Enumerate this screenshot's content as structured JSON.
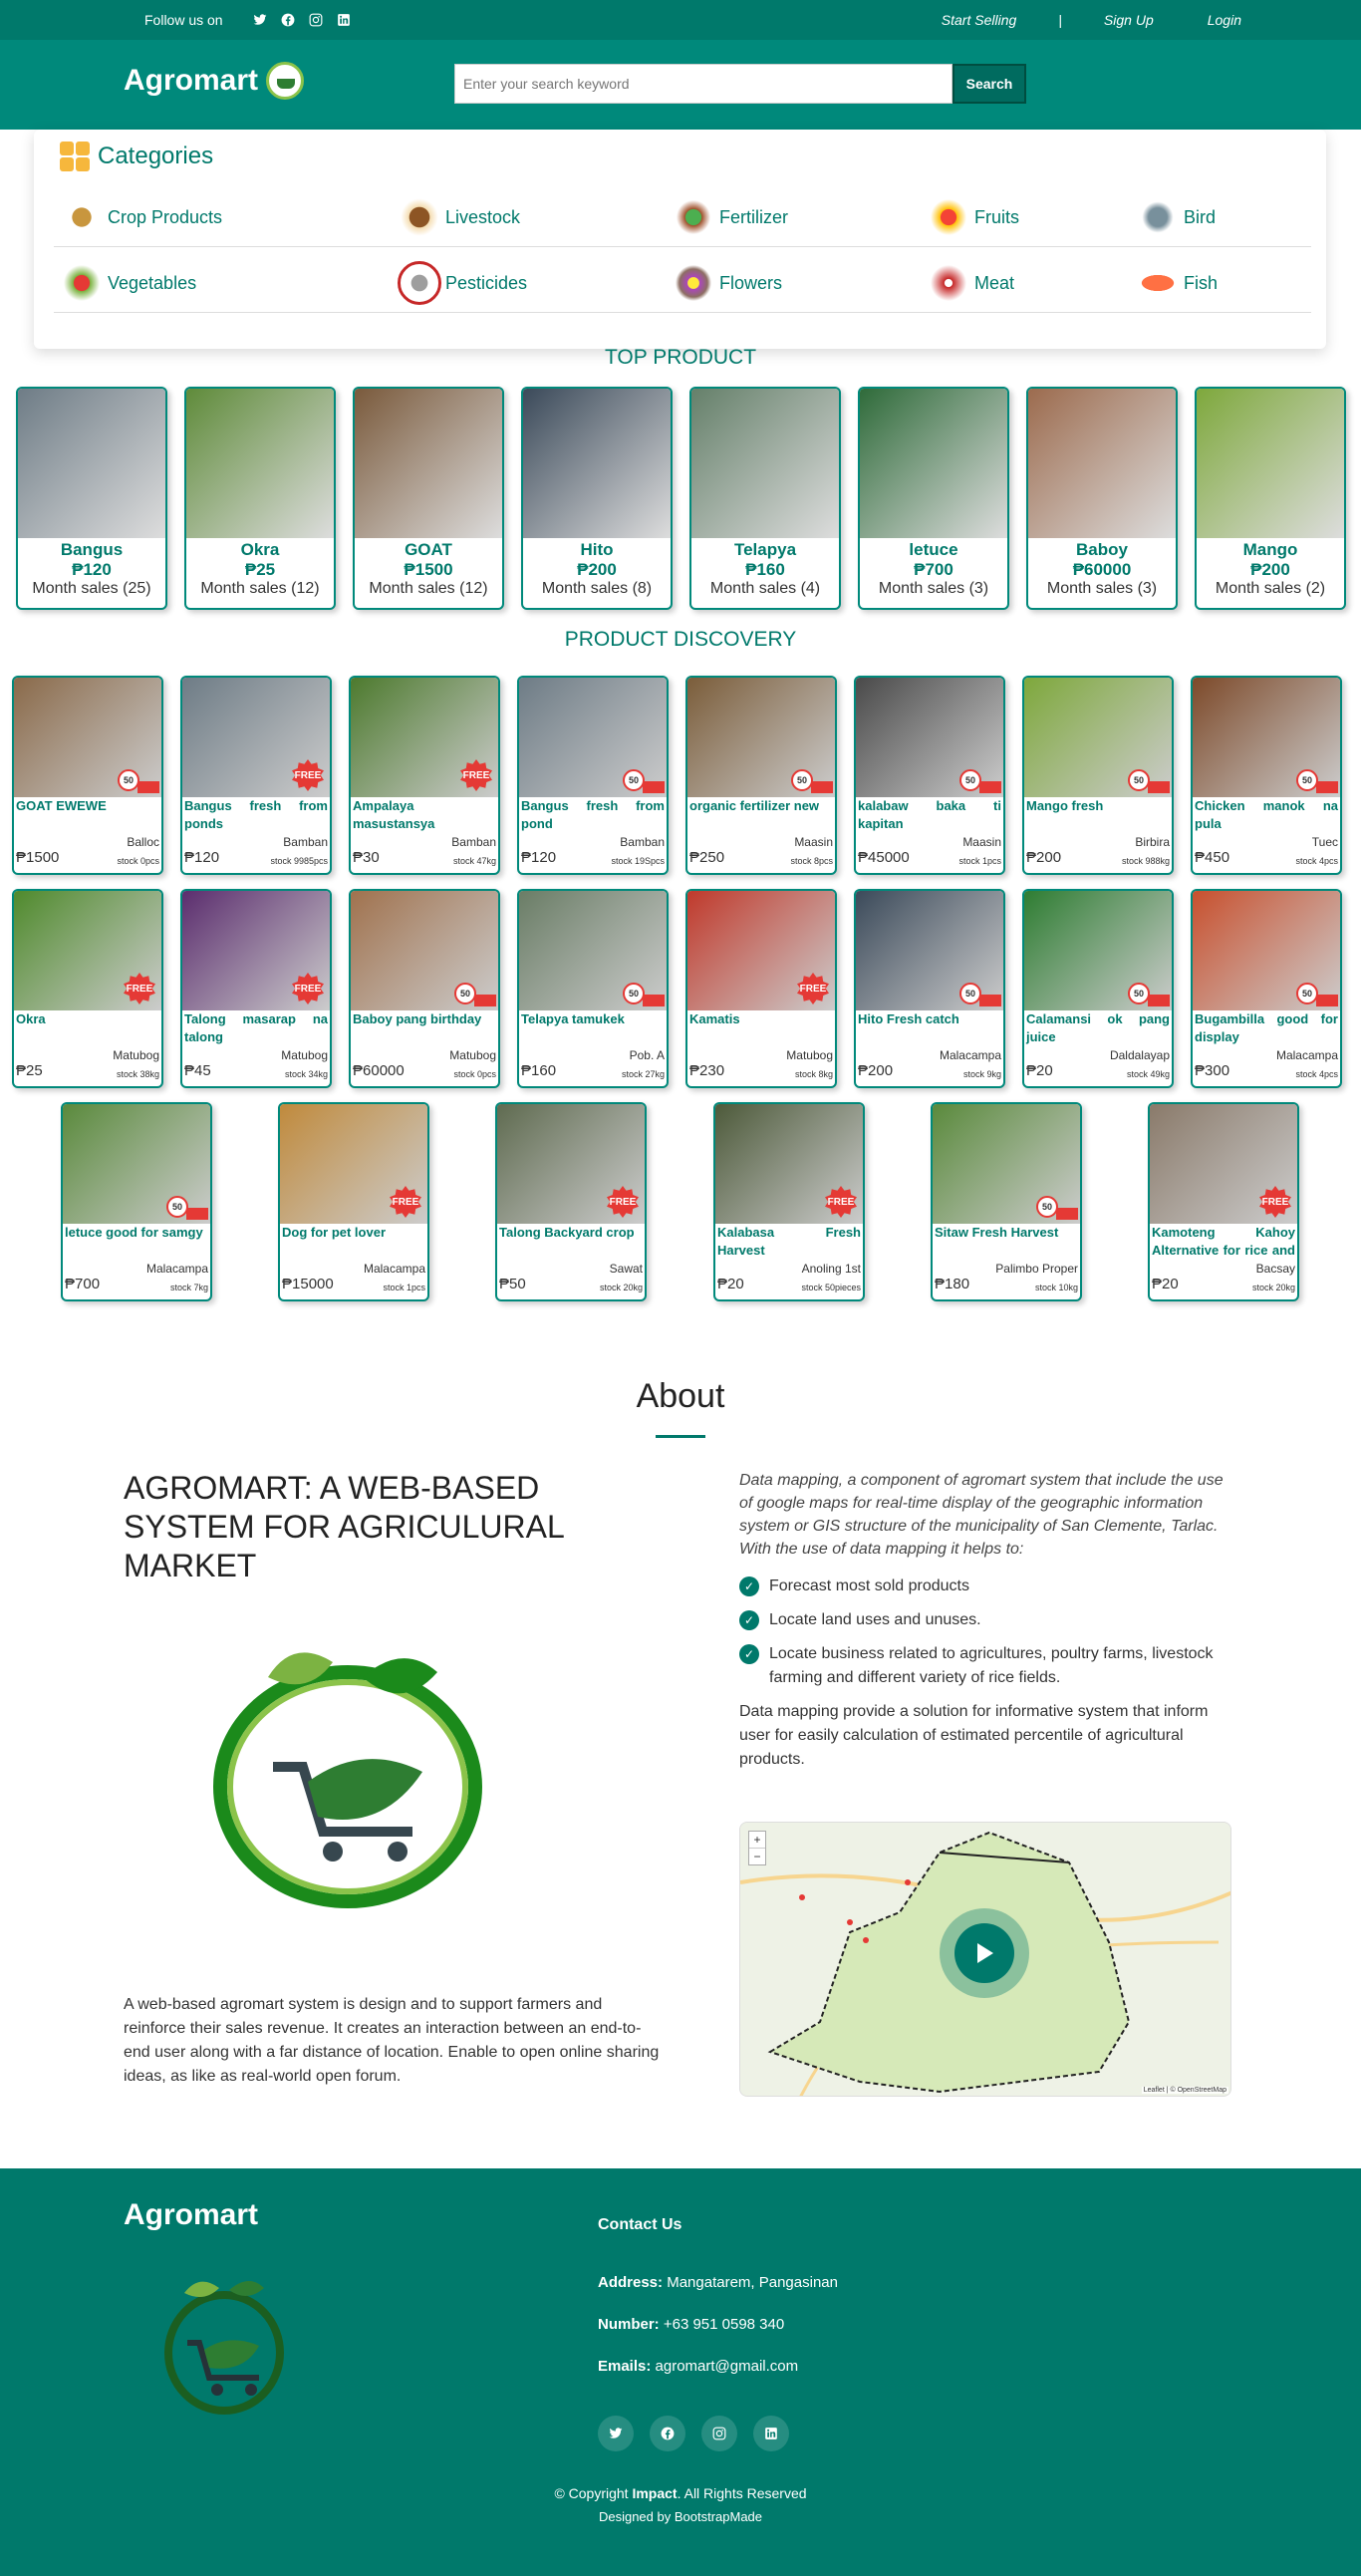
{
  "topbar": {
    "follow": "Follow us on",
    "start_selling": "Start Selling",
    "separator": "|",
    "sign_up": "Sign Up",
    "login": "Login"
  },
  "header": {
    "brand": "Agromart",
    "search_placeholder": "Enter your search keyword",
    "search_button": "Search"
  },
  "categories": {
    "title": "Categories",
    "row1": [
      "Crop Products",
      "Livestock",
      "Fertilizer",
      "Fruits",
      "Bird"
    ],
    "row2": [
      "Vegetables",
      "Pesticides",
      "Flowers",
      "Meat",
      "Fish"
    ]
  },
  "top_product": {
    "title": "TOP PRODUCT",
    "items": [
      {
        "name": "Bangus",
        "price": "₱120",
        "sales": "Month sales (25)"
      },
      {
        "name": "Okra",
        "price": "₱25",
        "sales": "Month sales (12)"
      },
      {
        "name": "GOAT",
        "price": "₱1500",
        "sales": "Month sales (12)"
      },
      {
        "name": "Hito",
        "price": "₱200",
        "sales": "Month sales (8)"
      },
      {
        "name": "Telapya",
        "price": "₱160",
        "sales": "Month sales (4)"
      },
      {
        "name": "letuce",
        "price": "₱700",
        "sales": "Month sales (3)"
      },
      {
        "name": "Baboy",
        "price": "₱60000",
        "sales": "Month sales (3)"
      },
      {
        "name": "Mango",
        "price": "₱200",
        "sales": "Month sales (2)"
      }
    ]
  },
  "discovery": {
    "title": "PRODUCT DISCOVERY",
    "items": [
      {
        "name": "GOAT EWEWE",
        "loc": "Balloc",
        "price": "₱1500",
        "stock": "stock 0pcs",
        "tag": "50"
      },
      {
        "name": "Bangus fresh from ponds",
        "loc": "Bamban",
        "price": "₱120",
        "stock": "stock 9985pcs",
        "tag": "FREE"
      },
      {
        "name": "Ampalaya masustansya",
        "loc": "Bamban",
        "price": "₱30",
        "stock": "stock 47kg",
        "tag": "FREE"
      },
      {
        "name": "Bangus fresh from pond",
        "loc": "Bamban",
        "price": "₱120",
        "stock": "stock 19Spcs",
        "tag": "50"
      },
      {
        "name": "organic fertilizer new",
        "loc": "Maasin",
        "price": "₱250",
        "stock": "stock 8pcs",
        "tag": "50"
      },
      {
        "name": "kalabaw baka ti kapitan",
        "loc": "Maasin",
        "price": "₱45000",
        "stock": "stock 1pcs",
        "tag": "50"
      },
      {
        "name": "Mango fresh",
        "loc": "Birbira",
        "price": "₱200",
        "stock": "stock 988kg",
        "tag": "50"
      },
      {
        "name": "Chicken manok na pula",
        "loc": "Tuec",
        "price": "₱450",
        "stock": "stock 4pcs",
        "tag": "50"
      },
      {
        "name": "Okra",
        "loc": "Matubog",
        "price": "₱25",
        "stock": "stock 38kg",
        "tag": "FREE"
      },
      {
        "name": "Talong masarap na talong",
        "loc": "Matubog",
        "price": "₱45",
        "stock": "stock 34kg",
        "tag": "FREE"
      },
      {
        "name": "Baboy pang birthday",
        "loc": "Matubog",
        "price": "₱60000",
        "stock": "stock 0pcs",
        "tag": "50"
      },
      {
        "name": "Telapya tamukek",
        "loc": "Pob. A",
        "price": "₱160",
        "stock": "stock 27kg",
        "tag": "50"
      },
      {
        "name": "Kamatis",
        "loc": "Matubog",
        "price": "₱230",
        "stock": "stock 8kg",
        "tag": "FREE"
      },
      {
        "name": "Hito Fresh catch",
        "loc": "Malacampa",
        "price": "₱200",
        "stock": "stock 9kg",
        "tag": "50"
      },
      {
        "name": "Calamansi ok pang juice",
        "loc": "Daldalayap",
        "price": "₱20",
        "stock": "stock 49kg",
        "tag": "50"
      },
      {
        "name": "Bugambilla good for display",
        "loc": "Malacampa",
        "price": "₱300",
        "stock": "stock 4pcs",
        "tag": "50"
      },
      {
        "name": "letuce good for samgy",
        "loc": "Malacampa",
        "price": "₱700",
        "stock": "stock 7kg",
        "tag": "50"
      },
      {
        "name": "Dog for pet lover",
        "loc": "Malacampa",
        "price": "₱15000",
        "stock": "stock 1pcs",
        "tag": "FREE"
      },
      {
        "name": "Talong Backyard crop",
        "loc": "Sawat",
        "price": "₱50",
        "stock": "stock 20kg",
        "tag": "FREE"
      },
      {
        "name": "Kalabasa Fresh Harvest",
        "loc": "Anoling 1st",
        "price": "₱20",
        "stock": "stock 50pieces",
        "tag": "FREE"
      },
      {
        "name": "Sitaw Fresh Harvest",
        "loc": "Palimbo Proper",
        "price": "₱180",
        "stock": "stock 10kg",
        "tag": "50"
      },
      {
        "name": "Kamoteng Kahoy Alternative for rice and it...",
        "loc": "Bacsay",
        "price": "₱20",
        "stock": "stock 20kg",
        "tag": "FREE"
      }
    ]
  },
  "about": {
    "title": "About",
    "heading": "AGROMART: A WEB-BASED SYSTEM FOR AGRICULURAL MARKET",
    "description": "A web-based agromart system is design and to support farmers and reinforce their sales revenue. It creates an interaction between an end-to-end user along with a far distance of location. Enable to open online sharing ideas, as like as real-world open forum.",
    "intro": "Data mapping, a component of agromart system that include the use of google maps for real-time display of the geographic information system or GIS structure of the municipality of San Clemente, Tarlac. With the use of data mapping it helps to:",
    "bullets": [
      "Forecast most sold products",
      "Locate land uses and unuses.",
      "Locate business related to agricultures, poultry farms, livestock farming and different variety of rice fields."
    ],
    "conclusion": "Data mapping provide a solution for informative system that inform user for easily calculation of estimated percentile of agricultural products.",
    "map_zoom_in": "+",
    "map_zoom_out": "−",
    "map_credit": "Leaflet | © OpenStreetMap"
  },
  "footer": {
    "brand": "Agromart",
    "contact_title": "Contact Us",
    "address_label": "Address:",
    "address": "Mangatarem, Pangasinan",
    "number_label": "Number:",
    "number": "+63 951 0598 340",
    "email_label": "Emails:",
    "email": "agromart@gmail.com",
    "copyright_pre": "© Copyright ",
    "copyright_brand": "Impact",
    "copyright_post": ". All Rights Reserved",
    "designed": "Designed by BootstrapMade"
  },
  "colors": {
    "primary": "#00796b",
    "accent": "#e53935"
  }
}
